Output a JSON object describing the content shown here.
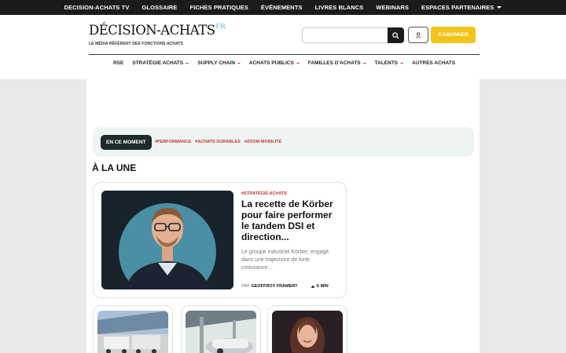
{
  "topbar": {
    "items": [
      "DECISION-ACHATS TV",
      "GLOSSAIRE",
      "FICHES PRATIQUES",
      "ÉVÉNEMENTS",
      "LIVRES BLANCS",
      "WEBINARS",
      "ESPACES PARTENAIRES"
    ]
  },
  "header": {
    "logo_word": "DÉCISION-ACHATS",
    "logo_suffix": "FR",
    "tagline": "LE MÉDIA RÉFÉRENT DES FONCTIONS ACHATS",
    "search_placeholder": "",
    "subscribe_label": "S'ABONNER"
  },
  "mainnav": {
    "items": [
      "RSE",
      "STRATÉGIE ACHATS",
      "SUPPLY CHAIN",
      "ACHATS PUBLICS",
      "FAMILLES D'ACHATS",
      "TALENTS",
      "AUTRES ACHATS"
    ]
  },
  "moment": {
    "label": "EN CE MOMENT",
    "tags": [
      "#PERFORMANCE",
      "#ACHATS DURABLES",
      "#ZOOM MOBILITÉ"
    ]
  },
  "une_heading": "À LA UNE",
  "feature": {
    "category": "#STRATÉGIE ACHATS",
    "title": "La recette de Körber pour faire performer le tandem DSI et direction...",
    "description": "Le groupe industriel Körber, engagé dans une trajectoire de forte croissance...",
    "by_prefix": "PAR",
    "author": "GEOFFROY FRAMERY",
    "read_time": "6 MIN"
  },
  "colors": {
    "accent": "#c0392b",
    "subscribe": "#f0c419",
    "dark": "#1b1b1b"
  }
}
